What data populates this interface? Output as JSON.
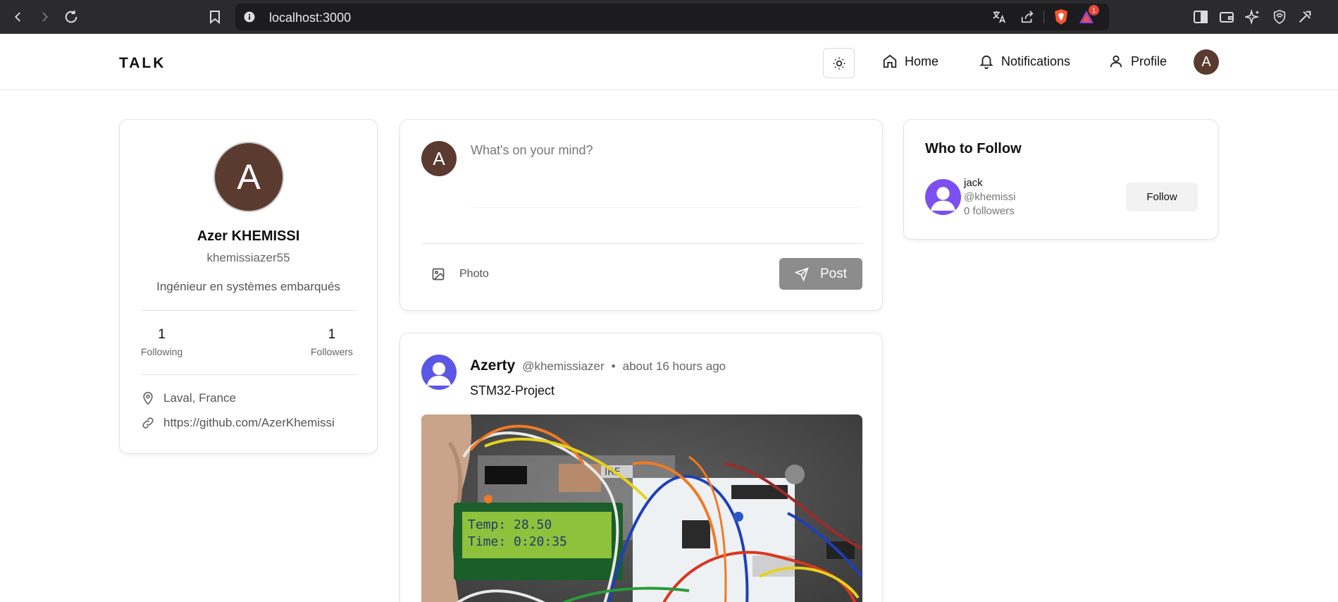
{
  "browser": {
    "url": "localhost:3000",
    "notification_badge": "1"
  },
  "header": {
    "logo": "TALK",
    "nav": {
      "home": "Home",
      "notifications": "Notifications",
      "profile": "Profile"
    },
    "avatar_initial": "A"
  },
  "profile": {
    "avatar_initial": "A",
    "name": "Azer KHEMISSI",
    "username": "khemissiazer55",
    "bio": "Ingénieur en systèmes embarqués",
    "following_count": "1",
    "following_label": "Following",
    "followers_count": "1",
    "followers_label": "Followers",
    "location": "Laval, France",
    "website": "https://github.com/AzerKhemissi"
  },
  "composer": {
    "avatar_initial": "A",
    "placeholder": "What's on your mind?",
    "photo_label": "Photo",
    "post_label": "Post"
  },
  "post": {
    "author": "Azerty",
    "handle": "@khemissiazer",
    "separator": "•",
    "time": "about 16 hours ago",
    "text": "STM32-Project",
    "lcd_line1": "Temp: 28.50",
    "lcd_line2": "Time: 0:20:35",
    "board_label": "IRE"
  },
  "who_to_follow": {
    "title": "Who to Follow",
    "users": [
      {
        "name": "jack",
        "handle": "@khemissi",
        "followers": "0 followers",
        "button": "Follow"
      }
    ]
  },
  "colors": {
    "avatar_brown": "#5b3a2f",
    "post_button_disabled": "#8c8c8c",
    "browser_chrome": "#2b2b2e"
  }
}
